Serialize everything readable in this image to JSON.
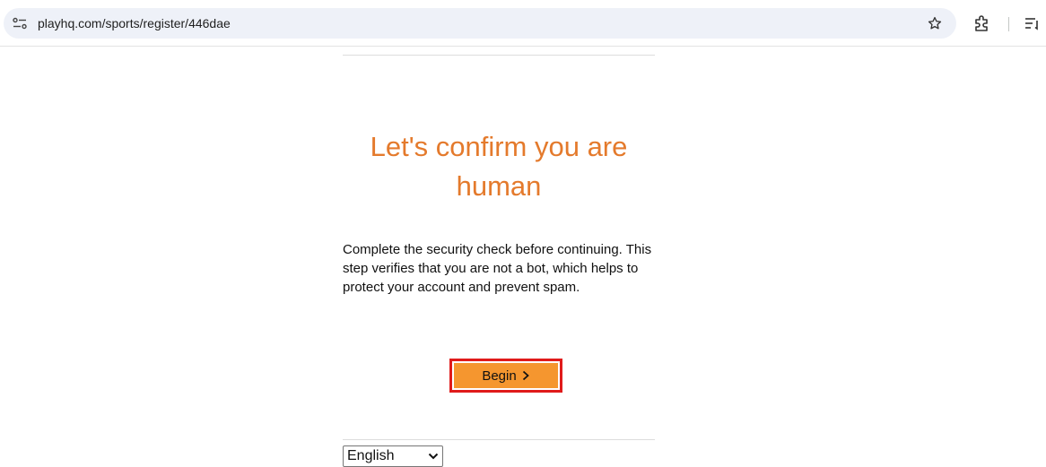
{
  "browser": {
    "url": "playhq.com/sports/register/446dae",
    "icons": [
      "site-info-icon",
      "bookmark-star-icon",
      "extensions-icon",
      "reading-list-icon"
    ]
  },
  "page": {
    "heading": "Let's confirm you are human",
    "description": "Complete the security check before continuing. This step verifies that you are not a bot, which helps to protect your account and prevent spam.",
    "begin_button": "Begin",
    "language_selected": "English"
  },
  "colors": {
    "heading": "#e47a2c",
    "button_fill": "#f5962f",
    "button_highlight_border": "#e01b1b"
  }
}
